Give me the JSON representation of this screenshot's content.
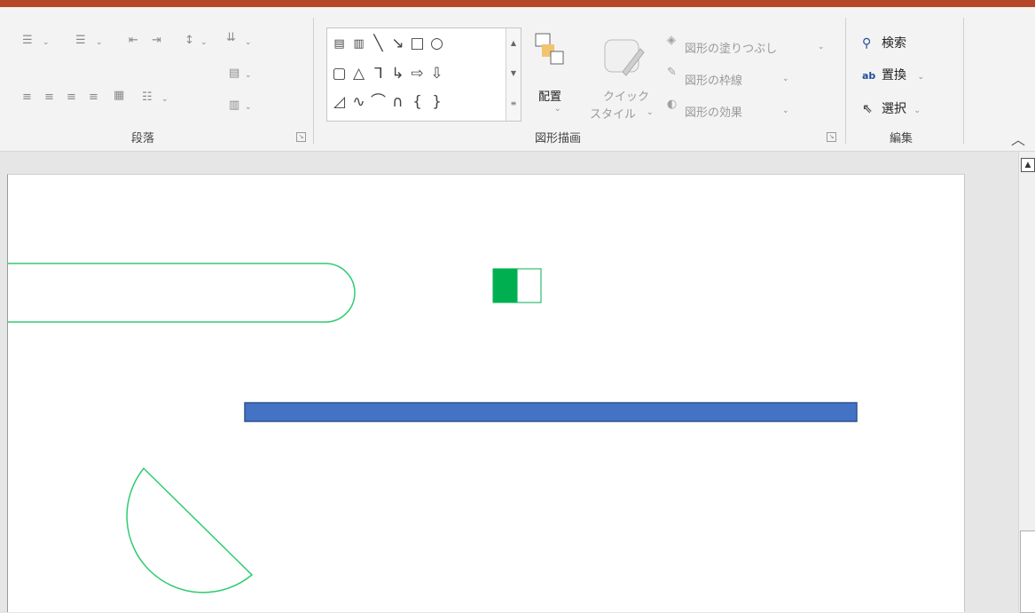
{
  "ribbon": {
    "paragraph": {
      "label": "段落",
      "launcher_icon": "dialog-launcher-icon"
    },
    "drawing": {
      "label": "図形描画",
      "launcher_icon": "dialog-launcher-icon",
      "arrange_label": "配置",
      "quick_style_line1": "クイック",
      "quick_style_line2": "スタイル",
      "shape_fill": "図形の塗りつぶし",
      "shape_outline": "図形の枠線",
      "shape_effects": "図形の効果"
    },
    "editing": {
      "label": "編集",
      "find": "検索",
      "replace": "置換",
      "select": "選択"
    }
  },
  "colors": {
    "title_bar": "#b7472a",
    "green_outline": "#2ecc71",
    "green_fill": "#00b050",
    "blue_bar": "#4472c4",
    "blue_border": "#2f528f"
  }
}
